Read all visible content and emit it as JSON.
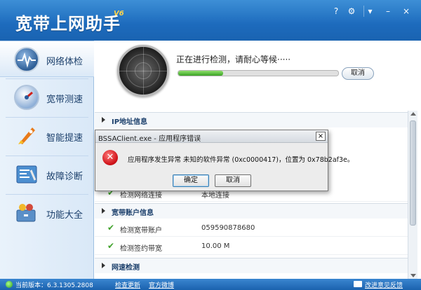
{
  "app": {
    "title": "宽带上网助手",
    "version": "V6"
  },
  "window_controls": [
    "?",
    "⚙",
    "▾",
    "–",
    "×"
  ],
  "sidebar": {
    "items": [
      {
        "label": "网络体检",
        "icon": "heartbeat-monitor-icon",
        "active": true
      },
      {
        "label": "宽带测速",
        "icon": "speedometer-icon",
        "active": false
      },
      {
        "label": "智能提速",
        "icon": "rocket-icon",
        "active": false
      },
      {
        "label": "故障诊断",
        "icon": "clipboard-diagnosis-icon",
        "active": false
      },
      {
        "label": "功能大全",
        "icon": "toolbox-icon",
        "active": false
      }
    ]
  },
  "main": {
    "status_text": "正在进行检测，请耐心等候·····",
    "progress": 0.28,
    "cancel_label": "取消",
    "sections": [
      {
        "title": "IP地址信息"
      },
      {
        "title": "宽带账户信息"
      },
      {
        "title": "网速检测"
      }
    ],
    "ip_row_partial": {
      "label": "检测网络连接",
      "value": "本地连接"
    },
    "account_rows": [
      {
        "label": "检测宽带账户",
        "value": "059590878680"
      },
      {
        "label": "检测签约带宽",
        "value": "10.00 M"
      }
    ]
  },
  "dialog": {
    "title": "BSSAClient.exe - 应用程序错误",
    "close": "×",
    "message": "应用程序发生异常 未知的软件异常 (0xc0000417)，位置为 0x78b2af3e。",
    "ok_label": "确定",
    "cancel_label": "取消"
  },
  "statusbar": {
    "version_label": "当前版本：6.3.1305.2808",
    "check_update": "检查更新",
    "official_weibo": "官方微博",
    "feedback": "改进意见反馈"
  },
  "colors": {
    "title_blue": "#1d6bbd",
    "progress_green": "#3aa224",
    "error_red": "#d0141a"
  }
}
